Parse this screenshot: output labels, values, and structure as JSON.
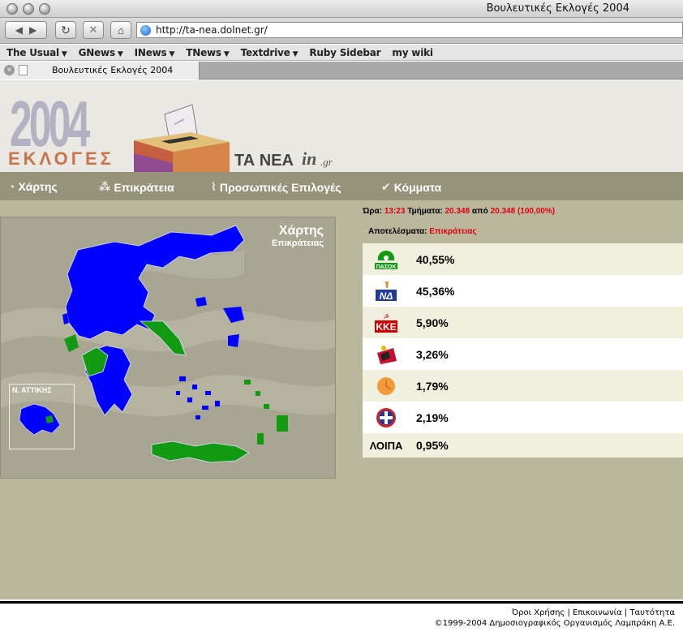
{
  "window": {
    "title": "Βουλευτικές Εκλογές 2004"
  },
  "toolbar": {
    "url": "http://ta-nea.dolnet.gr/"
  },
  "bookmarks": [
    {
      "label": "The Usual",
      "menu": true
    },
    {
      "label": "GNews",
      "menu": true
    },
    {
      "label": "INews",
      "menu": true
    },
    {
      "label": "TNews",
      "menu": true
    },
    {
      "label": "Textdrive",
      "menu": true
    },
    {
      "label": "Ruby Sidebar",
      "menu": false
    },
    {
      "label": "my wiki",
      "menu": false
    }
  ],
  "tab": {
    "title": "Βουλευτικές Εκλογές 2004"
  },
  "header": {
    "year": "2004",
    "word": "ΕΚΛΟΓΕΣ",
    "brand": "ΤΑ ΝΕΑ",
    "brand_in": "in",
    "brand_gr": ".gr"
  },
  "menu": {
    "map": "Χάρτης",
    "regions": "Επικράτεια",
    "personal": "Προσωπικές Επιλογές",
    "parties": "Κόμματα"
  },
  "map_panel": {
    "title": "Χάρτης",
    "subtitle": "Επικράτειας",
    "inset_label": "Ν. ΑΤΤΙΚΗΣ"
  },
  "status": {
    "time_label": "Ώρα:",
    "time": "13:23",
    "sections_label": "Τμήματα:",
    "sections_counted": "20.348",
    "of_label": "από",
    "sections_total": "20.348 (100,00%)",
    "results_label": "Αποτελέσματα:",
    "results_scope": "Επικράτειας"
  },
  "results": [
    {
      "party": "ΠΑΣΟΚ",
      "logo": "pasok-logo",
      "percent": "40,55%"
    },
    {
      "party": "ΝΔ",
      "logo": "nd-logo",
      "percent": "45,36%"
    },
    {
      "party": "ΚΚΕ",
      "logo": "kke-logo",
      "percent": "5,90%"
    },
    {
      "party": "ΣΥΝ",
      "logo": "syn-logo",
      "percent": "3,26%"
    },
    {
      "party": "ΔΗΚΚΙ",
      "logo": "dikki-logo",
      "percent": "1,79%"
    },
    {
      "party": "ΛΑΟΣ",
      "logo": "laos-logo",
      "percent": "2,19%"
    }
  ],
  "others": {
    "label": "ΛΟΙΠΑ",
    "percent": "0,95%"
  },
  "footer": {
    "terms": "Όροι Χρήσης",
    "contact": "Επικοινωνία",
    "identity": "Ταυτότητα",
    "copyright": "©1999-2004  Δημοσιογραφικός Οργανισμός Λαμπράκη Α.Ε."
  },
  "colors": {
    "nd_blue": "#0000ff",
    "pasok_green": "#129a12",
    "accent_red": "#e0000e",
    "page_bg": "#bab79c",
    "menu_bg": "#96937a"
  }
}
